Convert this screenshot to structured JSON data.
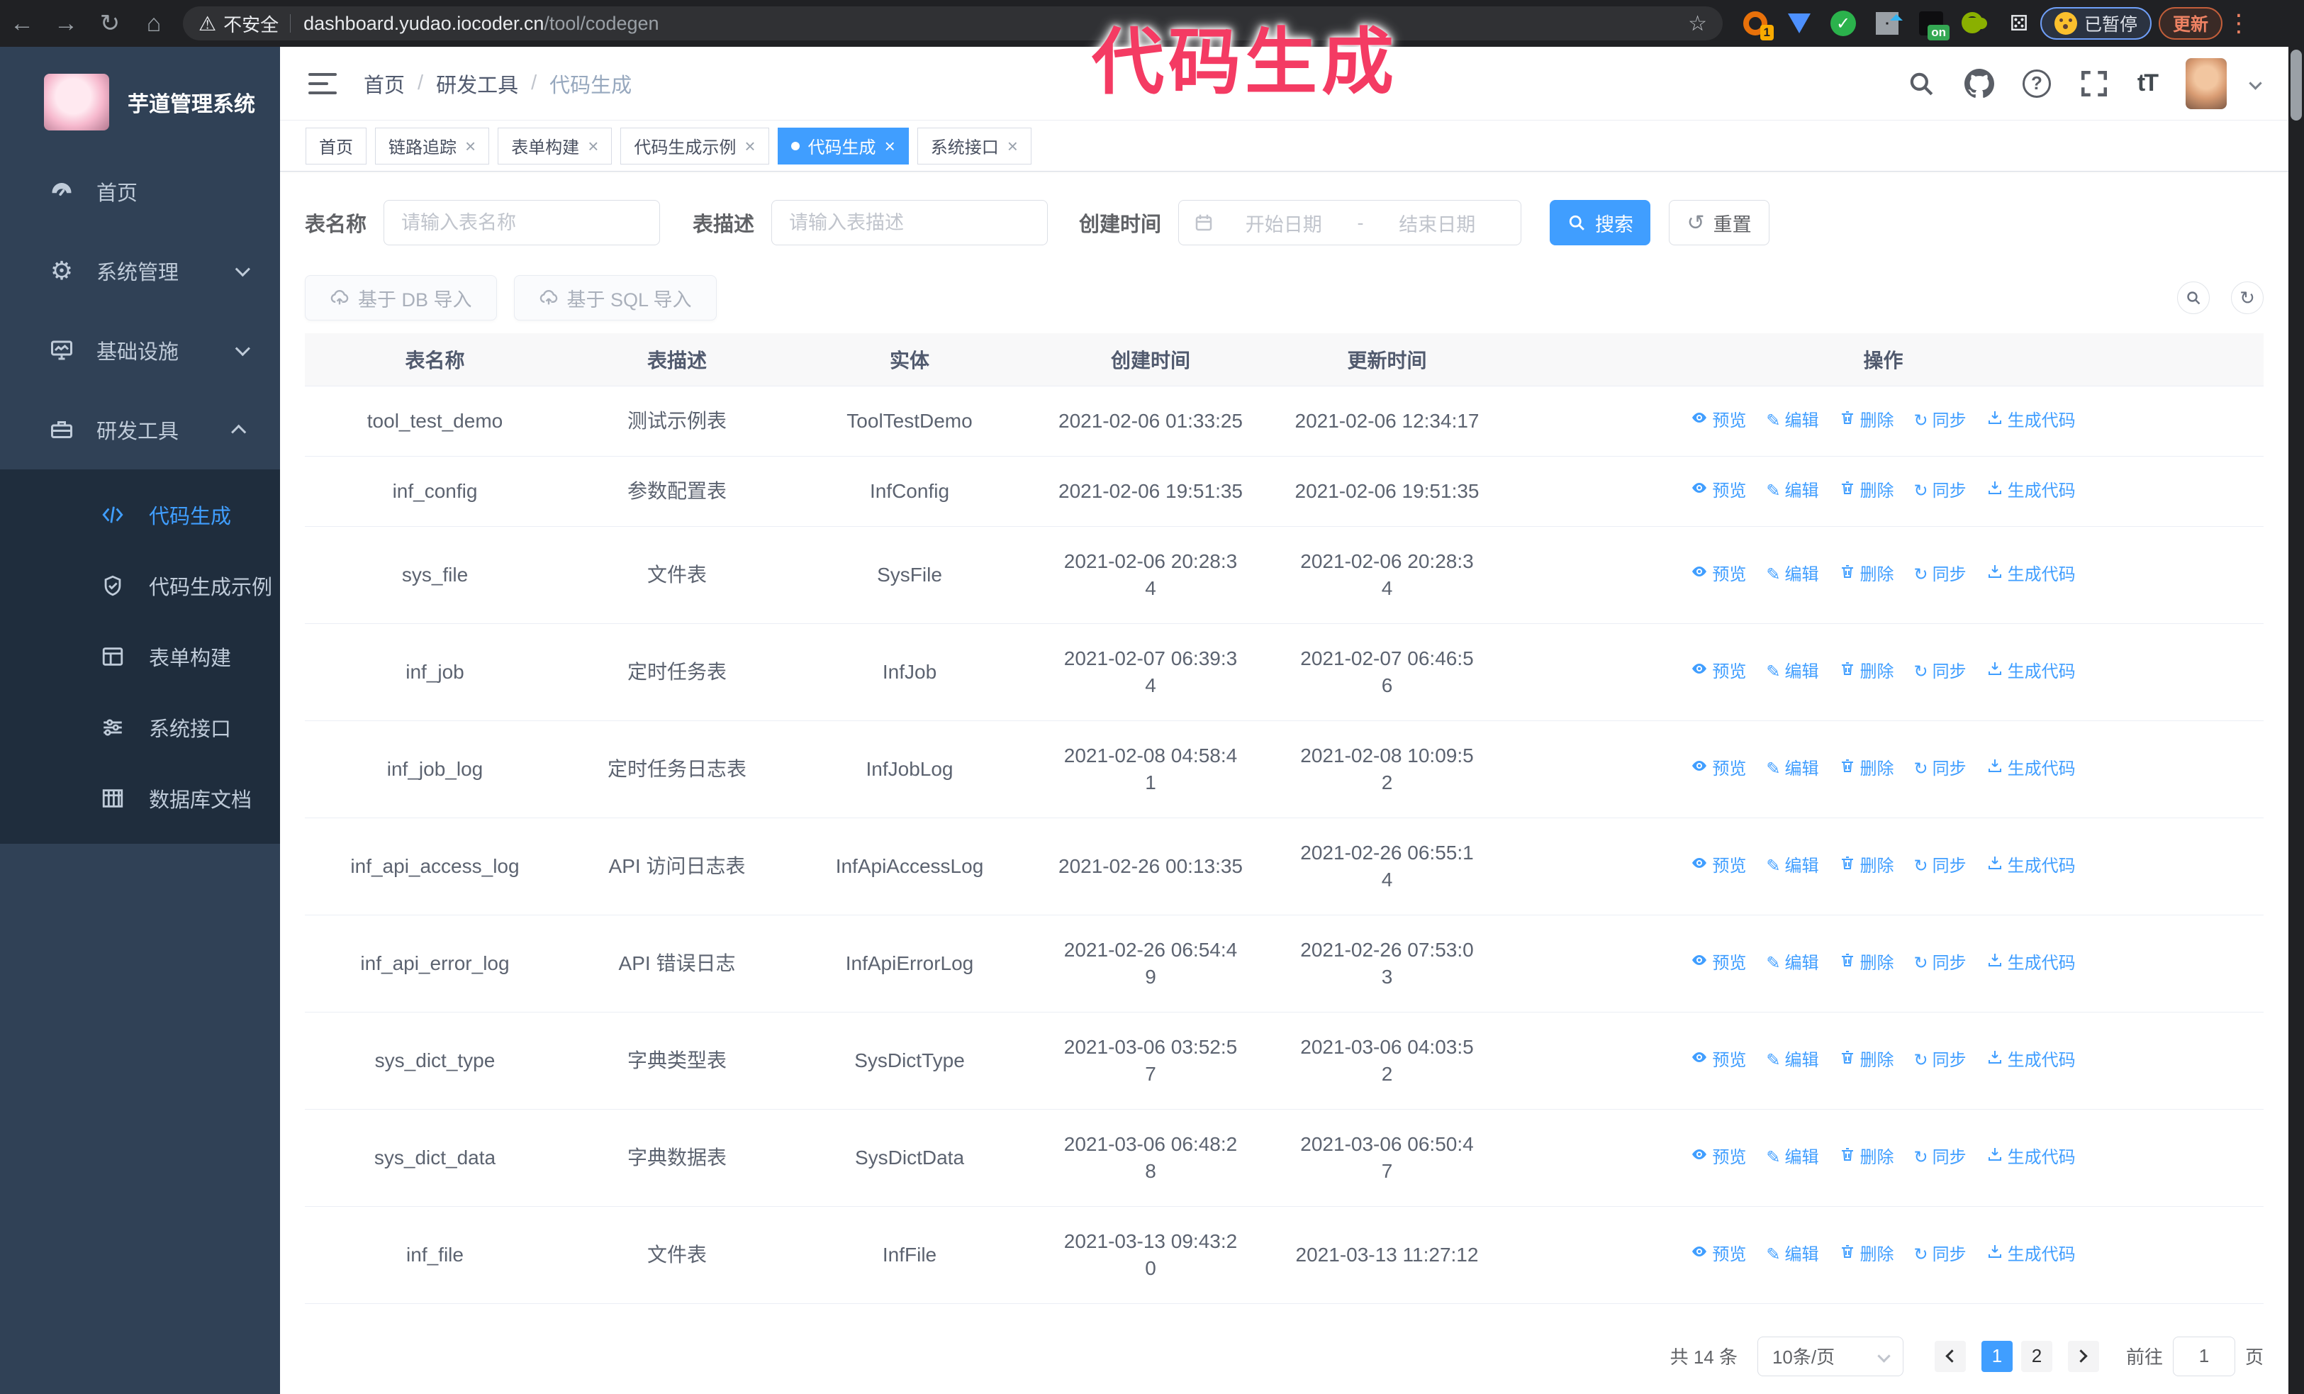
{
  "browser": {
    "security_label": "不安全",
    "url_host": "dashboard.yudao.iocoder.cn",
    "url_path": "/tool/codegen",
    "ext_badge_count": "1",
    "ext_badge_on": "on",
    "paused_label": "已暂停",
    "update_label": "更新"
  },
  "overlay_title": "代码生成",
  "sidebar": {
    "app_title": "芋道管理系统",
    "items": [
      {
        "label": "首页",
        "icon": "dashboard-icon",
        "expandable": false,
        "expanded": false
      },
      {
        "label": "系统管理",
        "icon": "gear-icon",
        "expandable": true,
        "expanded": false
      },
      {
        "label": "基础设施",
        "icon": "monitor-icon",
        "expandable": true,
        "expanded": false
      },
      {
        "label": "研发工具",
        "icon": "toolbox-icon",
        "expandable": true,
        "expanded": true
      }
    ],
    "submenu": [
      {
        "label": "代码生成",
        "icon": "code-icon",
        "active": true
      },
      {
        "label": "代码生成示例",
        "icon": "shield-check-icon",
        "active": false
      },
      {
        "label": "表单构建",
        "icon": "form-icon",
        "active": false
      },
      {
        "label": "系统接口",
        "icon": "sliders-icon",
        "active": false
      },
      {
        "label": "数据库文档",
        "icon": "grid-icon",
        "active": false
      }
    ]
  },
  "header": {
    "breadcrumb": [
      "首页",
      "研发工具",
      "代码生成"
    ]
  },
  "tabs": [
    {
      "label": "首页",
      "closable": false,
      "active": false
    },
    {
      "label": "链路追踪",
      "closable": true,
      "active": false
    },
    {
      "label": "表单构建",
      "closable": true,
      "active": false
    },
    {
      "label": "代码生成示例",
      "closable": true,
      "active": false
    },
    {
      "label": "代码生成",
      "closable": true,
      "active": true
    },
    {
      "label": "系统接口",
      "closable": true,
      "active": false
    }
  ],
  "filters": {
    "table_name_label": "表名称",
    "table_name_placeholder": "请输入表名称",
    "table_desc_label": "表描述",
    "table_desc_placeholder": "请输入表描述",
    "create_time_label": "创建时间",
    "date_start_placeholder": "开始日期",
    "date_separator": "-",
    "date_end_placeholder": "结束日期",
    "search_label": "搜索",
    "reset_label": "重置"
  },
  "toolbar": {
    "import_db_label": "基于 DB 导入",
    "import_sql_label": "基于 SQL 导入"
  },
  "table": {
    "columns": [
      "表名称",
      "表描述",
      "实体",
      "创建时间",
      "更新时间",
      "操作"
    ],
    "action_labels": [
      "预览",
      "编辑",
      "删除",
      "同步",
      "生成代码"
    ],
    "rows": [
      {
        "name": "tool_test_demo",
        "desc": "测试示例表",
        "entity": "ToolTestDemo",
        "created": "2021-02-06 01:33:25",
        "updated": "2021-02-06 12:34:17"
      },
      {
        "name": "inf_config",
        "desc": "参数配置表",
        "entity": "InfConfig",
        "created": "2021-02-06 19:51:35",
        "updated": "2021-02-06 19:51:35"
      },
      {
        "name": "sys_file",
        "desc": "文件表",
        "entity": "SysFile",
        "created": "2021-02-06 20:28:3\n4",
        "updated": "2021-02-06 20:28:3\n4"
      },
      {
        "name": "inf_job",
        "desc": "定时任务表",
        "entity": "InfJob",
        "created": "2021-02-07 06:39:3\n4",
        "updated": "2021-02-07 06:46:5\n6"
      },
      {
        "name": "inf_job_log",
        "desc": "定时任务日志表",
        "entity": "InfJobLog",
        "created": "2021-02-08 04:58:4\n1",
        "updated": "2021-02-08 10:09:5\n2"
      },
      {
        "name": "inf_api_access_log",
        "desc": "API 访问日志表",
        "entity": "InfApiAccessLog",
        "created": "2021-02-26 00:13:35",
        "updated": "2021-02-26 06:55:1\n4"
      },
      {
        "name": "inf_api_error_log",
        "desc": "API 错误日志",
        "entity": "InfApiErrorLog",
        "created": "2021-02-26 06:54:4\n9",
        "updated": "2021-02-26 07:53:0\n3"
      },
      {
        "name": "sys_dict_type",
        "desc": "字典类型表",
        "entity": "SysDictType",
        "created": "2021-03-06 03:52:5\n7",
        "updated": "2021-03-06 04:03:5\n2"
      },
      {
        "name": "sys_dict_data",
        "desc": "字典数据表",
        "entity": "SysDictData",
        "created": "2021-03-06 06:48:2\n8",
        "updated": "2021-03-06 06:50:4\n7"
      },
      {
        "name": "inf_file",
        "desc": "文件表",
        "entity": "InfFile",
        "created": "2021-03-13 09:43:2\n0",
        "updated": "2021-03-13 11:27:12"
      }
    ]
  },
  "pagination": {
    "total_label": "共 14 条",
    "page_size_label": "10条/页",
    "pages": [
      "1",
      "2"
    ],
    "active_page": "1",
    "goto_label": "前往",
    "goto_value": "1",
    "goto_suffix": "页"
  },
  "icons": {
    "back": "←",
    "forward": "→",
    "reload": "↻",
    "home": "⌂",
    "warning": "⚠",
    "star": "☆",
    "puzzle": "⚄",
    "kebab-dots": "⋮",
    "gear": "⚙",
    "pencil": "✎",
    "sync": "↻",
    "reset": "↺",
    "close": "×",
    "check": "✓"
  },
  "colors": {
    "accent": "#409eff",
    "overlay_annotation": "#f43b63",
    "sidebar_bg": "#304156",
    "submenu_bg": "#1f2d3d",
    "chrome_bg": "#202124",
    "table_header_bg": "#f8f8f9"
  }
}
